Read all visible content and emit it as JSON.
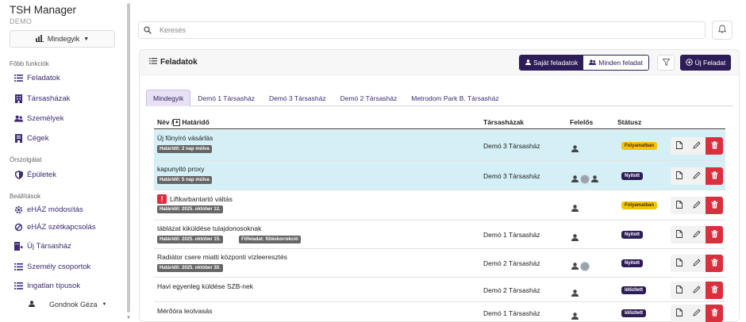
{
  "app": {
    "title": "TSH Manager",
    "subtitle": "DEMO"
  },
  "sidebar": {
    "filter_label": "Mindegyik",
    "sections": [
      {
        "title": "Főbb funkciók",
        "items": [
          {
            "label": "Feladatok",
            "icon": "list-icon"
          },
          {
            "label": "Társasházak",
            "icon": "building-icon"
          },
          {
            "label": "Személyek",
            "icon": "users-icon"
          },
          {
            "label": "Cégek",
            "icon": "company-icon"
          }
        ]
      },
      {
        "title": "Őrszolgálat",
        "items": [
          {
            "label": "Épületek",
            "icon": "shield-icon"
          }
        ]
      },
      {
        "title": "Beállítások",
        "items": [
          {
            "label": "eHÁZ módosítás",
            "icon": "gear-icon"
          },
          {
            "label": "eHÁZ szétkapcsolás",
            "icon": "unlink-icon"
          },
          {
            "label": "Új Társasház",
            "icon": "building-plus-icon"
          },
          {
            "label": "Személy csoportok",
            "icon": "list-icon"
          },
          {
            "label": "Ingatlan típusok",
            "icon": "list-icon"
          }
        ]
      }
    ],
    "user": "Gondnok Géza"
  },
  "search": {
    "placeholder": "Keresés",
    "value": ""
  },
  "card": {
    "title": "Feladatok",
    "own_tasks_label": "Saját feladatok",
    "all_tasks_label": "Minden feladat",
    "new_task_label": "Új Feladat"
  },
  "tabs": [
    "Mindegyik",
    "Demó 1 Társasház",
    "Demó 3 Társasház",
    "Demó 2 Társasház",
    "Metrodom Park B. Társasház"
  ],
  "active_tab": "Mindegyik",
  "table": {
    "headers": {
      "name": "Név / ",
      "deadline": "Határidő",
      "house": "Társasházak",
      "owner": "Felelős",
      "status": "Státusz"
    },
    "rows": [
      {
        "title": "Új fűnyíró vásárlás",
        "chips": [
          "Határidő: 2 nap múlva"
        ],
        "house": "Demó 3 Társasház",
        "status": "Folyamatban",
        "status_type": "run",
        "highlight": true,
        "urgent": false
      },
      {
        "title": "kapunyitó proxy",
        "chips": [
          "Határidő: 5 nap múlva"
        ],
        "house": "Demó 3 Társasház",
        "status": "Nyitott",
        "status_type": "ok",
        "highlight": true,
        "urgent": false
      },
      {
        "title": "Liftkarbantartó váltás",
        "chips": [
          "Határidő: 2025. október 12."
        ],
        "house": "",
        "status": "Folyamatban",
        "status_type": "run",
        "highlight": false,
        "urgent": true
      },
      {
        "title": "táblázat kiküldése tulajdonosoknak",
        "chips": [
          "Határidő: 2025. október 15.",
          "Főfeladat: fűtéskorrekció"
        ],
        "house": "Demó 1 Társasház",
        "status": "Nyitott",
        "status_type": "ok",
        "highlight": false,
        "urgent": false
      },
      {
        "title": "Radiátor csere miatti központi vízleeresztés",
        "chips": [
          "Határidő: 2025. október 30."
        ],
        "house": "Demó 2 Társasház",
        "status": "Nyitott",
        "status_type": "ok",
        "highlight": false,
        "urgent": false
      },
      {
        "title": "Havi egyenleg küldése SZB-nek",
        "chips": [],
        "house": "Demó 2 Társasház",
        "status": "Időzített",
        "status_type": "ok",
        "highlight": false,
        "urgent": false
      },
      {
        "title": "Mérőóra leolvasás",
        "chips": [],
        "house": "Demó 1 Társasház",
        "status": "Időzített",
        "status_type": "ok",
        "highlight": false,
        "urgent": false
      }
    ]
  },
  "colors": {
    "primary": "#2e1c57",
    "highlight_row": "#d4f0f6",
    "danger": "#d9303e",
    "warning": "#f5c400"
  }
}
